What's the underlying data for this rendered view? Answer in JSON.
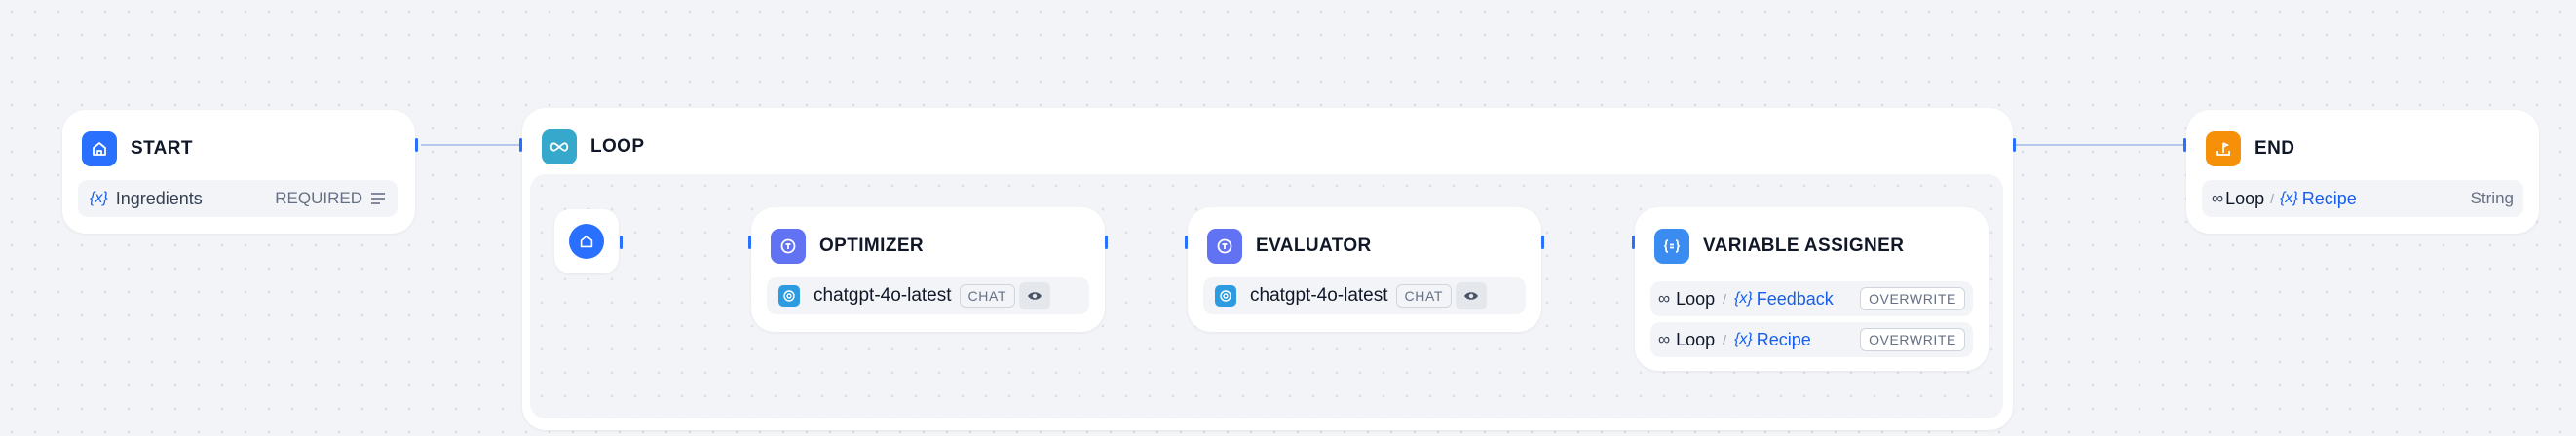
{
  "colors": {
    "canvas": "#f2f4f7",
    "start_icon": "#2970ff",
    "loop_icon": "#36a8cc",
    "llm_icon": "#6172f3",
    "assigner_icon": "#3a8cf0",
    "end_icon": "#f79009",
    "accent": "#155eef",
    "edge": "#b6c7ea"
  },
  "start": {
    "title": "START",
    "icon": "home-icon",
    "variable": {
      "prefix": "{x}",
      "name": "Ingredients",
      "badge": "REQUIRED"
    }
  },
  "loop": {
    "title": "LOOP",
    "icon": "infinity-icon",
    "start_icon": "home-icon"
  },
  "optimizer": {
    "title": "OPTIMIZER",
    "icon": "llm-icon",
    "model": {
      "name": "chatgpt-4o-latest",
      "mode": "CHAT",
      "icon": "openai-icon"
    }
  },
  "evaluator": {
    "title": "EVALUATOR",
    "icon": "llm-icon",
    "model": {
      "name": "chatgpt-4o-latest",
      "mode": "CHAT",
      "icon": "openai-icon"
    }
  },
  "assigner": {
    "title": "VARIABLE ASSIGNER",
    "icon": "assign-icon",
    "rows": [
      {
        "scope": "Loop",
        "sep": "/",
        "prefix": "{x}",
        "name": "Feedback",
        "mode": "OVERWRITE"
      },
      {
        "scope": "Loop",
        "sep": "/",
        "prefix": "{x}",
        "name": "Recipe",
        "mode": "OVERWRITE"
      }
    ]
  },
  "end": {
    "title": "END",
    "icon": "flag-icon",
    "output": {
      "scope": "Loop",
      "sep": "/",
      "prefix": "{x}",
      "name": "Recipe",
      "type": "String"
    }
  }
}
